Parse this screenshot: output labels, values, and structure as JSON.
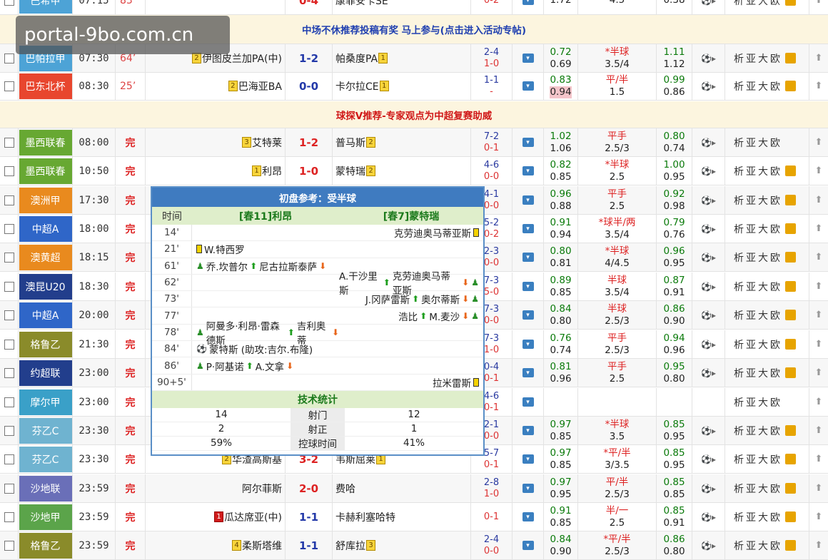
{
  "banners": {
    "top": "中场不休推荐投稿有奖 马上参与(点击进入活动专帖)",
    "mid": "球探V推荐-专家观点为中超复赛助威"
  },
  "links_text": "析亚大欧",
  "watermark": "portal-9bo.com.cn",
  "colors": {
    "aqua": "#4da3d6",
    "arg": "#5ba44a",
    "mex": "#67a832",
    "aus": "#e98a1e",
    "csl": "#2f66c8",
    "geo": "#8a8b2a",
    "oceania": "#223e8c",
    "mar": "#3aa0c8",
    "fin": "#6fb3d0",
    "ksa": "#6a6fb8"
  },
  "rows": [
    {
      "league": "巴希甲",
      "color": "#4da3d6",
      "time": "07:15",
      "status": "83",
      "live": true,
      "home": "",
      "home_rank": "",
      "score": "0-4",
      "away": "康菲安卡SE",
      "away_rank": "",
      "half_top": "",
      "half_bot": "0-2",
      "o1_top": "",
      "o1_bot": "1.72",
      "o2_top": "",
      "o2_bot": "4.5",
      "o3_top": "",
      "o3_bot": "0.38",
      "lock": true
    },
    {
      "league": "巴帕拉甲",
      "color": "#4da3d6",
      "time": "07:30",
      "status": "64",
      "live": true,
      "home": "伊图皮兰加PA(中)",
      "home_rank": "2",
      "score": "1-2",
      "away": "帕桑度PA",
      "away_rank": "1",
      "half_top": "2-4",
      "half_bot": "1-0",
      "o1_top": "0.72",
      "o1_bot": "0.69",
      "o2_top": "*半球",
      "o2_bot": "3.5/4",
      "o3_top": "1.11",
      "o3_bot": "1.12",
      "lock": true
    },
    {
      "league": "巴东北杯",
      "color": "#e8462e",
      "time": "08:30",
      "status": "25",
      "live": true,
      "home": "巴海亚BA",
      "home_rank": "2",
      "score": "0-0",
      "away": "卡尔拉CE",
      "away_rank": "1",
      "half_top": "1-1",
      "half_bot": "-",
      "o1_top": "0.83",
      "o1_bot": "0.94",
      "o2_top": "平/半",
      "o2_bot": "1.5",
      "o3_top": "0.99",
      "o3_bot": "0.86",
      "lock": true
    },
    {
      "league": "墨西联春",
      "color": "#67a832",
      "time": "08:00",
      "status": "完",
      "live": false,
      "home": "艾特莱",
      "home_rank": "3",
      "score": "1-2",
      "away": "普马斯",
      "away_rank": "2",
      "half_top": "7-2",
      "half_bot": "0-1",
      "o1_top": "1.02",
      "o1_bot": "1.06",
      "o2_top": "平手",
      "o2_bot": "2.5/3",
      "o3_top": "0.80",
      "o3_bot": "0.74",
      "lock": false
    },
    {
      "league": "墨西联春",
      "color": "#67a832",
      "time": "10:50",
      "status": "完",
      "live": false,
      "home": "利昂",
      "home_rank": "1",
      "score": "1-0",
      "away": "蒙特瑞",
      "away_rank": "2",
      "half_top": "4-6",
      "half_bot": "0-0",
      "o1_top": "0.82",
      "o1_bot": "0.85",
      "o2_top": "*半球",
      "o2_bot": "2.5",
      "o3_top": "1.00",
      "o3_bot": "0.95",
      "lock": true
    },
    {
      "league": "澳洲甲",
      "color": "#e98a1e",
      "time": "17:30",
      "status": "完",
      "live": false,
      "home": "",
      "home_rank": "",
      "score": "",
      "away": "",
      "away_rank": "",
      "half_top": "4-1",
      "half_bot": "0-0",
      "o1_top": "0.96",
      "o1_bot": "0.88",
      "o2_top": "平手",
      "o2_bot": "2.5",
      "o3_top": "0.92",
      "o3_bot": "0.98",
      "lock": true
    },
    {
      "league": "中超A",
      "color": "#2f66c8",
      "time": "18:00",
      "status": "完",
      "live": false,
      "home": "",
      "home_rank": "",
      "score": "",
      "away": "",
      "away_rank": "",
      "half_top": "5-2",
      "half_bot": "0-2",
      "o1_top": "0.91",
      "o1_bot": "0.94",
      "o2_top": "*球半/两",
      "o2_bot": "3.5/4",
      "o3_top": "0.79",
      "o3_bot": "0.76",
      "lock": true
    },
    {
      "league": "澳黄超",
      "color": "#e98a1e",
      "time": "18:15",
      "status": "完",
      "live": false,
      "home": "",
      "home_rank": "",
      "score": "",
      "away": "",
      "away_rank": "",
      "half_top": "2-3",
      "half_bot": "0-0",
      "o1_top": "0.80",
      "o1_bot": "0.81",
      "o2_top": "*半球",
      "o2_bot": "4/4.5",
      "o3_top": "0.96",
      "o3_bot": "0.95",
      "lock": true
    },
    {
      "league": "澳昆U20",
      "color": "#223e8c",
      "time": "18:30",
      "status": "完",
      "live": false,
      "home": "",
      "home_rank": "",
      "score": "",
      "away": "",
      "away_rank": "",
      "half_top": "7-3",
      "half_bot": "5-0",
      "o1_top": "0.89",
      "o1_bot": "0.85",
      "o2_top": "半球",
      "o2_bot": "3.5/4",
      "o3_top": "0.87",
      "o3_bot": "0.91",
      "lock": true
    },
    {
      "league": "中超A",
      "color": "#2f66c8",
      "time": "20:00",
      "status": "完",
      "live": false,
      "home": "",
      "home_rank": "",
      "score": "",
      "away": "",
      "away_rank": "",
      "half_top": "7-3",
      "half_bot": "0-0",
      "o1_top": "0.84",
      "o1_bot": "0.80",
      "o2_top": "半球",
      "o2_bot": "2.5/3",
      "o3_top": "0.86",
      "o3_bot": "0.90",
      "lock": true
    },
    {
      "league": "格鲁乙",
      "color": "#8a8b2a",
      "time": "21:30",
      "status": "完",
      "live": false,
      "home": "",
      "home_rank": "",
      "score": "",
      "away": "",
      "away_rank": "",
      "half_top": "7-3",
      "half_bot": "1-0",
      "o1_top": "0.76",
      "o1_bot": "0.74",
      "o2_top": "平手",
      "o2_bot": "2.5/3",
      "o3_top": "0.94",
      "o3_bot": "0.96",
      "lock": true
    },
    {
      "league": "约超联",
      "color": "#223e8c",
      "time": "23:00",
      "status": "完",
      "live": false,
      "home": "",
      "home_rank": "",
      "score": "",
      "away": "",
      "away_rank": "",
      "half_top": "0-4",
      "half_bot": "0-1",
      "o1_top": "0.81",
      "o1_bot": "0.96",
      "o2_top": "平手",
      "o2_bot": "2.5",
      "o3_top": "0.95",
      "o3_bot": "0.80",
      "lock": true
    },
    {
      "league": "摩尔甲",
      "color": "#3aa0c8",
      "time": "23:00",
      "status": "完",
      "live": false,
      "home": "",
      "home_rank": "",
      "score": "",
      "away": "",
      "away_rank": "",
      "half_top": "4-6",
      "half_bot": "0-1",
      "o1_top": "",
      "o1_bot": "",
      "o2_top": "",
      "o2_bot": "",
      "o3_top": "",
      "o3_bot": "",
      "lock": false
    },
    {
      "league": "芬乙C",
      "color": "#6fb3d0",
      "time": "23:30",
      "status": "完",
      "live": false,
      "home": "",
      "home_rank": "",
      "score": "",
      "away": "",
      "away_rank": "",
      "half_top": "2-1",
      "half_bot": "0-0",
      "o1_top": "0.97",
      "o1_bot": "0.85",
      "o2_top": "*半球",
      "o2_bot": "3.5",
      "o3_top": "0.85",
      "o3_bot": "0.95",
      "lock": true
    },
    {
      "league": "芬乙C",
      "color": "#6fb3d0",
      "time": "23:30",
      "status": "完",
      "live": false,
      "home": "华渣高斯基",
      "home_rank": "2",
      "score": "3-2",
      "away": "韦斯屈莱",
      "away_rank": "1",
      "half_top": "5-7",
      "half_bot": "0-1",
      "o1_top": "0.97",
      "o1_bot": "0.85",
      "o2_top": "*平/半",
      "o2_bot": "3/3.5",
      "o3_top": "0.85",
      "o3_bot": "0.95",
      "lock": true
    },
    {
      "league": "沙地联",
      "color": "#6a6fb8",
      "time": "23:59",
      "status": "完",
      "live": false,
      "home": "阿尔菲斯",
      "home_rank": "",
      "score": "2-0",
      "away": "费哈",
      "away_rank": "",
      "half_top": "2-8",
      "half_bot": "1-0",
      "o1_top": "0.97",
      "o1_bot": "0.95",
      "o2_top": "平/半",
      "o2_bot": "2.5/3",
      "o3_top": "0.85",
      "o3_bot": "0.85",
      "lock": true
    },
    {
      "league": "沙地甲",
      "color": "#5ba44a",
      "time": "23:59",
      "status": "完",
      "live": false,
      "home": "瓜达席亚(中)",
      "home_rank": "1",
      "score": "1-1",
      "away": "卡赫利塞哈特",
      "away_rank": "",
      "half_top": "",
      "half_bot": "0-1",
      "o1_top": "0.91",
      "o1_bot": "0.85",
      "o2_top": "半/一",
      "o2_bot": "2.5",
      "o3_top": "0.85",
      "o3_bot": "0.91",
      "lock": true
    },
    {
      "league": "格鲁乙",
      "color": "#8a8b2a",
      "time": "23:59",
      "status": "完",
      "live": false,
      "home": "柔斯塔维",
      "home_rank": "4",
      "score": "1-1",
      "away": "舒库拉",
      "away_rank": "3",
      "half_top": "2-4",
      "half_bot": "0-0",
      "o1_top": "0.84",
      "o1_bot": "0.90",
      "o2_top": "*平/半",
      "o2_bot": "2.5/3",
      "o3_top": "0.86",
      "o3_bot": "0.80",
      "lock": true
    }
  ],
  "popup": {
    "title": "初盘参考：受半球",
    "col_time": "时间",
    "home_team": "[春11]利昂",
    "away_team": "[春7]蒙特瑞",
    "events": [
      {
        "min": "14'",
        "side": "away",
        "items": [
          "克劳迪奥马蒂亚斯"
        ],
        "kind": "ycard"
      },
      {
        "min": "21'",
        "side": "home",
        "items": [
          "W.特西罗"
        ],
        "kind": "ycard"
      },
      {
        "min": "61'",
        "side": "home",
        "items": [
          "乔.坎普尔",
          "尼古拉斯泰萨"
        ],
        "kind": "sub"
      },
      {
        "min": "62'",
        "side": "away",
        "items": [
          "A.干沙里斯",
          "克劳迪奥马蒂亚斯"
        ],
        "kind": "sub"
      },
      {
        "min": "73'",
        "side": "away",
        "items": [
          "J.冈萨雷斯",
          "奥尔蒂斯"
        ],
        "kind": "sub"
      },
      {
        "min": "77'",
        "side": "away",
        "items": [
          "浩比",
          "M.麦沙"
        ],
        "kind": "sub"
      },
      {
        "min": "78'",
        "side": "home",
        "items": [
          "阿曼多·利昂·雷森德斯",
          "吉利奥蒂"
        ],
        "kind": "sub"
      },
      {
        "min": "84'",
        "side": "home",
        "items": [
          "蒙特斯 (助攻:吉尔.布隆)"
        ],
        "kind": "goal"
      },
      {
        "min": "86'",
        "side": "home",
        "items": [
          "P·阿基诺",
          "A.文拿"
        ],
        "kind": "sub"
      },
      {
        "min": "90+5'",
        "side": "away",
        "items": [
          "拉米雷斯"
        ],
        "kind": "ycard"
      }
    ],
    "tech_title": "技术统计",
    "stats": [
      {
        "label": "射门",
        "home": "14",
        "away": "12"
      },
      {
        "label": "射正",
        "home": "2",
        "away": "1"
      },
      {
        "label": "控球时间",
        "home": "59%",
        "away": "41%"
      }
    ]
  }
}
